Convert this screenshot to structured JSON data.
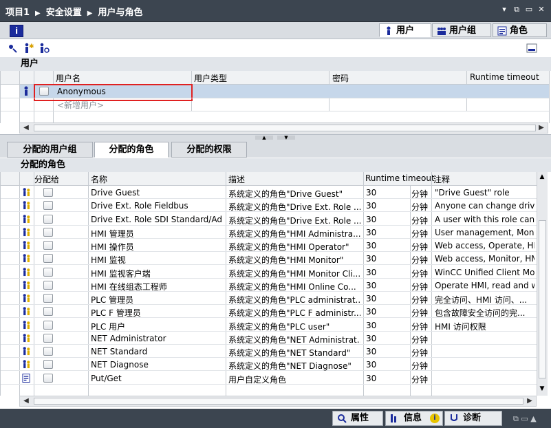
{
  "breadcrumb": [
    "项目1",
    "安全设置",
    "用户与角色"
  ],
  "window_buttons": [
    "▾",
    "⧉",
    "▭",
    "✕"
  ],
  "top_tabs": [
    {
      "label": "用户",
      "icon": "user-icon",
      "active": true
    },
    {
      "label": "用户组",
      "icon": "user-group-icon",
      "active": false
    },
    {
      "label": "角色",
      "icon": "role-icon",
      "active": false
    }
  ],
  "users_section_title": "用户",
  "users_columns": [
    "用户名",
    "用户类型",
    "密码",
    "Runtime timeout"
  ],
  "users_rows": [
    {
      "name": "Anonymous"
    }
  ],
  "users_add_placeholder": "<新增用户>",
  "lower_tabs": [
    {
      "label": "分配的用户组",
      "active": false
    },
    {
      "label": "分配的角色",
      "active": true
    },
    {
      "label": "分配的权限",
      "active": false
    }
  ],
  "roles_section_title": "分配的角色",
  "roles_columns": [
    "分配给",
    "名称",
    "描述",
    "Runtime timeout",
    "注释"
  ],
  "roles": [
    {
      "name": "Drive Guest",
      "desc": "系统定义的角色\"Drive Guest\"",
      "timeout": "30",
      "unit": "分钟",
      "note": "\"Drive Guest\" role",
      "icon": "system-role-icon"
    },
    {
      "name": "Drive Ext. Role Fieldbus",
      "desc": "系统定义的角色\"Drive Ext. Role ...",
      "timeout": "30",
      "unit": "分钟",
      "note": "Anyone can change drive...",
      "icon": "system-role-icon"
    },
    {
      "name": "Drive Ext. Role SDI Standard/Adv",
      "desc": "系统定义的角色\"Drive Ext. Role ...",
      "timeout": "30",
      "unit": "分钟",
      "note": "A user with this role can ...",
      "icon": "system-role-icon"
    },
    {
      "name": "HMI 管理员",
      "desc": "系统定义的角色\"HMI Administra...",
      "timeout": "30",
      "unit": "分钟",
      "note": "User management, Moni...",
      "icon": "system-role-icon"
    },
    {
      "name": "HMI 操作员",
      "desc": "系统定义的角色\"HMI Operator\"",
      "timeout": "30",
      "unit": "分钟",
      "note": "Web access, Operate, HM...",
      "icon": "system-role-icon"
    },
    {
      "name": "HMI 监视",
      "desc": "系统定义的角色\"HMI Monitor\"",
      "timeout": "30",
      "unit": "分钟",
      "note": "Web access, Monitor, HM...",
      "icon": "system-role-icon"
    },
    {
      "name": "HMI 监视客户端",
      "desc": "系统定义的角色\"HMI Monitor Cli...",
      "timeout": "30",
      "unit": "分钟",
      "note": "WinCC Unified Client Mo...",
      "icon": "system-role-icon"
    },
    {
      "name": "HMI 在线组态工程师",
      "desc": "系统定义的角色\"HMI Online Co...",
      "timeout": "30",
      "unit": "分钟",
      "note": "Operate HMI, read and w...",
      "icon": "system-role-icon"
    },
    {
      "name": "PLC 管理员",
      "desc": "系统定义的角色\"PLC administrat...",
      "timeout": "30",
      "unit": "分钟",
      "note": "完全访问、HMI 访问、...",
      "icon": "system-role-icon"
    },
    {
      "name": "PLC F 管理员",
      "desc": "系统定义的角色\"PLC F administr...",
      "timeout": "30",
      "unit": "分钟",
      "note": "包含故障安全访问的完...",
      "icon": "system-role-icon"
    },
    {
      "name": "PLC 用户",
      "desc": "系统定义的角色\"PLC user\"",
      "timeout": "30",
      "unit": "分钟",
      "note": "HMI 访问权限",
      "icon": "system-role-icon"
    },
    {
      "name": "NET Administrator",
      "desc": "系统定义的角色\"NET Administrat...",
      "timeout": "30",
      "unit": "分钟",
      "note": "",
      "icon": "system-role-icon"
    },
    {
      "name": "NET Standard",
      "desc": "系统定义的角色\"NET Standard\"",
      "timeout": "30",
      "unit": "分钟",
      "note": "",
      "icon": "system-role-icon"
    },
    {
      "name": "NET Diagnose",
      "desc": "系统定义的角色\"NET Diagnose\"",
      "timeout": "30",
      "unit": "分钟",
      "note": "",
      "icon": "system-role-icon"
    },
    {
      "name": "Put/Get",
      "desc": "用户自定义角色",
      "timeout": "30",
      "unit": "分钟",
      "note": "",
      "icon": "user-defined-role-icon"
    }
  ],
  "status_tabs": [
    {
      "label": "属性",
      "icon": "properties-icon"
    },
    {
      "label": "信息",
      "icon": "info-icon"
    },
    {
      "label": "诊断",
      "icon": "diagnostics-icon"
    }
  ],
  "colors": {
    "titlebar": "#3c4550",
    "selection": "#c6d7ea",
    "highlight_box": "#e02020",
    "info_blue": "#1b2c9c"
  }
}
